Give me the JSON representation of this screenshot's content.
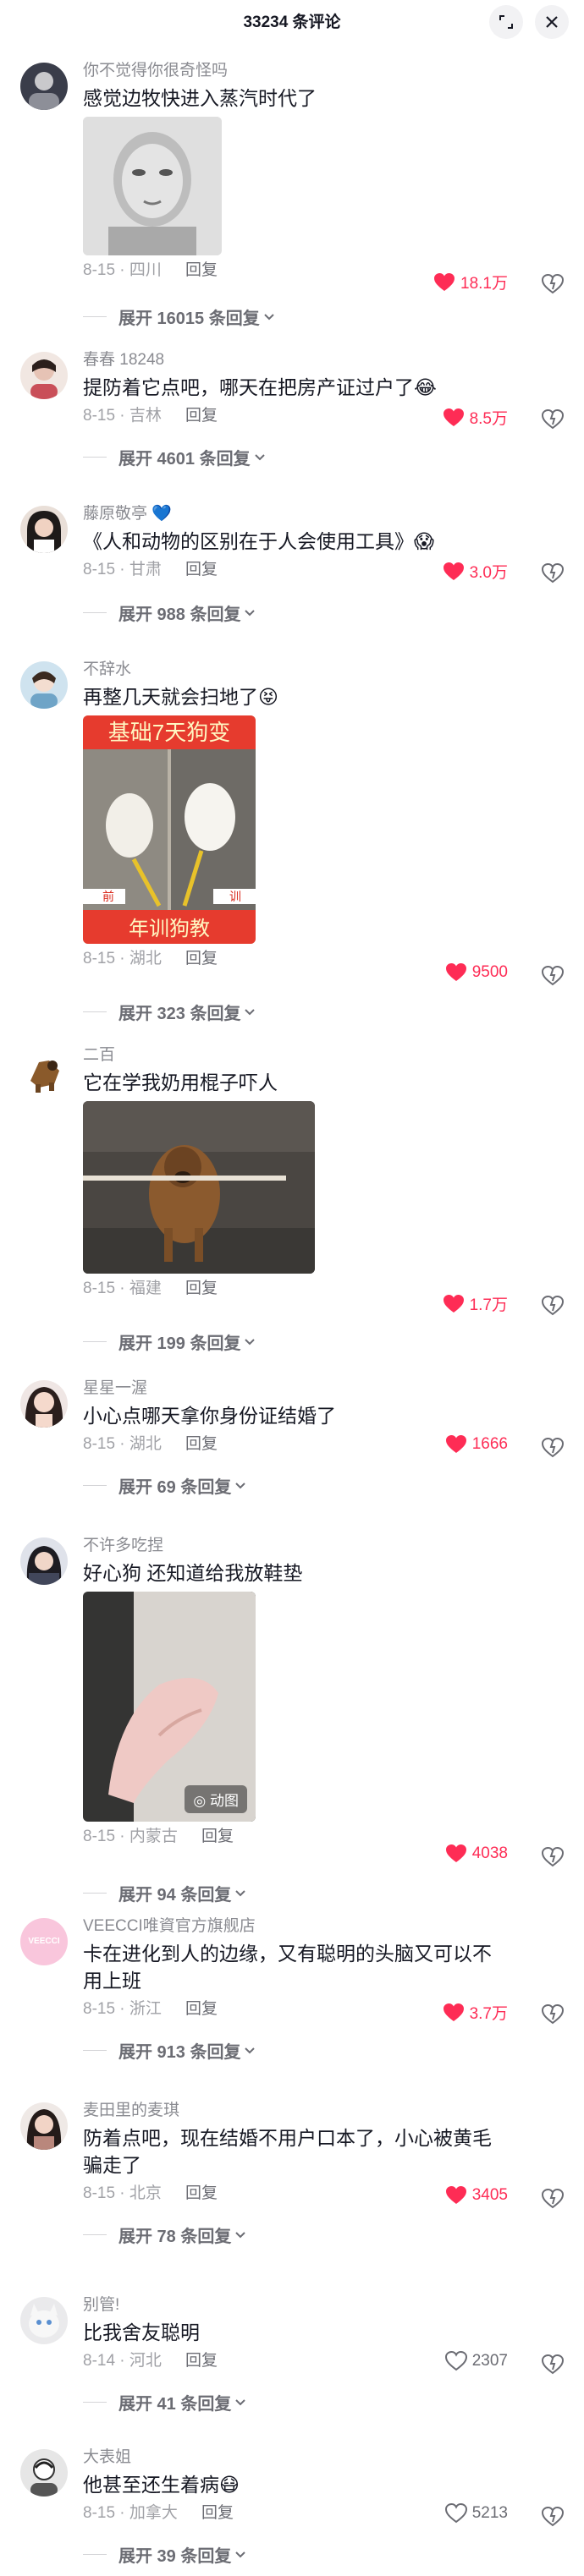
{
  "header": {
    "title": "33234 条评论"
  },
  "comments": [
    {
      "user": "你不觉得你很奇怪吗",
      "text": "感觉边牧快进入蒸汽时代了",
      "date": "8-15",
      "loc": "四川",
      "reply": "回复",
      "likes": "18.1万",
      "liked": true,
      "expand": "展开 16015 条回复"
    },
    {
      "user": "春春 18248",
      "text": "提防着它点吧，哪天在把房产证过户了😂",
      "date": "8-15",
      "loc": "吉林",
      "reply": "回复",
      "likes": "8.5万",
      "liked": true,
      "expand": "展开 4601 条回复"
    },
    {
      "user": "藤原敬亭 💙",
      "text": "《人和动物的区别在于人会使用工具》😱",
      "date": "8-15",
      "loc": "甘肃",
      "reply": "回复",
      "likes": "3.0万",
      "liked": true,
      "expand": "展开 988 条回复"
    },
    {
      "user": "不辞水",
      "text": "再整几天就会扫地了😝",
      "date": "8-15",
      "loc": "湖北",
      "reply": "回复",
      "likes": "9500",
      "liked": true,
      "expand": "展开 323 条回复",
      "media_text": [
        "基础7天狗变",
        "训",
        "前",
        "年训狗教"
      ]
    },
    {
      "user": "二百",
      "text": "它在学我奶用棍子吓人",
      "date": "8-15",
      "loc": "福建",
      "reply": "回复",
      "likes": "1.7万",
      "liked": true,
      "expand": "展开 199 条回复"
    },
    {
      "user": "星星一渥",
      "text": "小心点哪天拿你身份证结婚了",
      "date": "8-15",
      "loc": "湖北",
      "reply": "回复",
      "likes": "1666",
      "liked": true,
      "expand": "展开 69 条回复"
    },
    {
      "user": "不许多吃捏",
      "text": "好心狗 还知道给我放鞋垫",
      "date": "8-15",
      "loc": "内蒙古",
      "reply": "回复",
      "likes": "4038",
      "liked": true,
      "expand": "展开 94 条回复",
      "badge": "动图"
    },
    {
      "user": "VEECCI唯資官方旗舰店",
      "text": "卡在进化到人的边缘，又有聪明的头脑又可以不用上班",
      "date": "8-15",
      "loc": "浙江",
      "reply": "回复",
      "likes": "3.7万",
      "liked": true,
      "expand": "展开 913 条回复",
      "avatar_text": "VEECCI"
    },
    {
      "user": "麦田里的麦琪",
      "text": "防着点吧，现在结婚不用户口本了，小心被黄毛骗走了",
      "date": "8-15",
      "loc": "北京",
      "reply": "回复",
      "likes": "3405",
      "liked": true,
      "expand": "展开 78 条回复"
    },
    {
      "user": "别管!",
      "text": "比我舍友聪明",
      "date": "8-14",
      "loc": "河北",
      "reply": "回复",
      "likes": "2307",
      "liked": false,
      "expand": "展开 41 条回复"
    },
    {
      "user": "大表姐",
      "text": "他甚至还生着病😷",
      "date": "8-15",
      "loc": "加拿大",
      "reply": "回复",
      "likes": "5213",
      "liked": false,
      "expand": "展开 39 条回复"
    }
  ]
}
